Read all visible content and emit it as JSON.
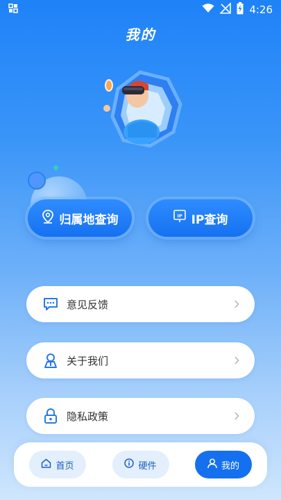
{
  "status": {
    "time": "4:26"
  },
  "header": {
    "title": "我的"
  },
  "quick_actions": [
    {
      "label": "归属地查询",
      "icon": "location-pin-icon"
    },
    {
      "label": "IP查询",
      "icon": "ip-icon"
    }
  ],
  "menu": [
    {
      "label": "意见反馈",
      "icon": "feedback-icon"
    },
    {
      "label": "关于我们",
      "icon": "about-us-icon"
    },
    {
      "label": "隐私政策",
      "icon": "lock-icon"
    }
  ],
  "tabbar": {
    "tabs": [
      {
        "label": "首页",
        "icon": "home-icon"
      },
      {
        "label": "硬件",
        "icon": "info-icon"
      },
      {
        "label": "我的",
        "icon": "user-icon",
        "active": true
      }
    ]
  },
  "colors": {
    "accent": "#1570ef",
    "icon_blue": "#2a78e8"
  }
}
